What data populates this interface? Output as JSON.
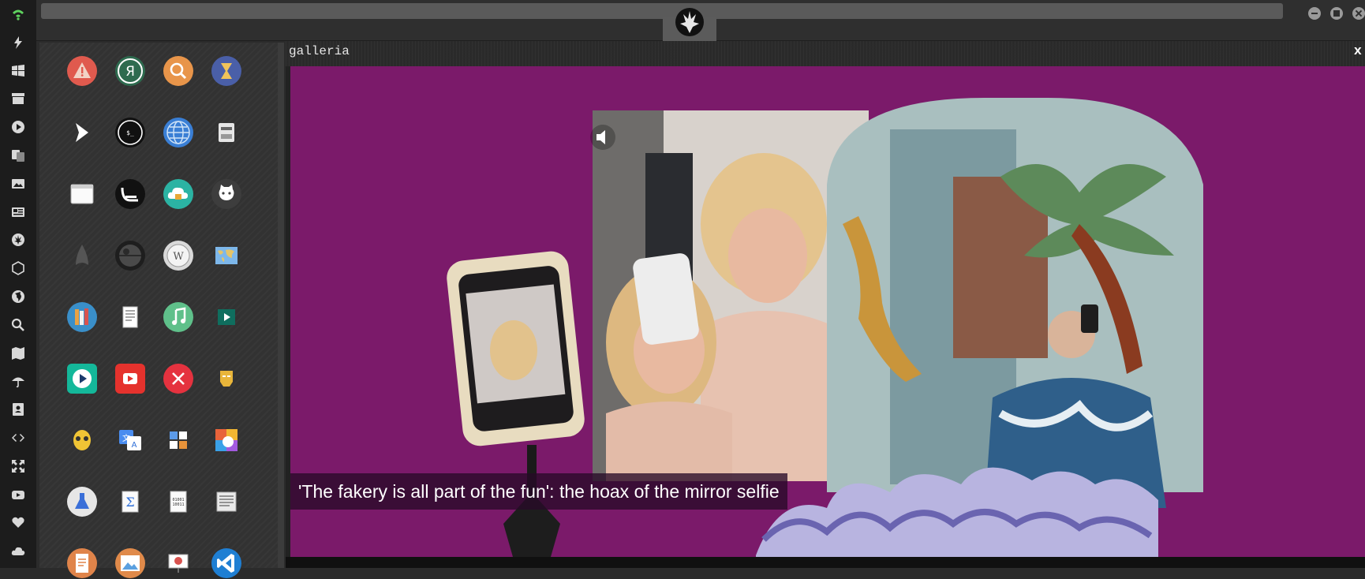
{
  "dock": {
    "items": [
      {
        "icon": "wifi-icon"
      },
      {
        "icon": "lightning-icon"
      },
      {
        "icon": "windows-icon"
      },
      {
        "icon": "archive-icon"
      },
      {
        "icon": "play-circle-icon"
      },
      {
        "icon": "translate-icon"
      },
      {
        "icon": "image-icon"
      },
      {
        "icon": "newspaper-icon"
      },
      {
        "icon": "rebel-alliance-icon"
      },
      {
        "icon": "hexagon-icon"
      },
      {
        "icon": "globe-icon"
      },
      {
        "icon": "search-icon"
      },
      {
        "icon": "map-icon"
      },
      {
        "icon": "umbrella-icon"
      },
      {
        "icon": "contact-card-icon"
      },
      {
        "icon": "code-icon"
      },
      {
        "icon": "expand-icon"
      },
      {
        "icon": "youtube-icon"
      },
      {
        "icon": "heart-icon"
      },
      {
        "icon": "cloud-icon"
      }
    ]
  },
  "topbar": {
    "logo_icon": "rebel-alliance-icon",
    "window_buttons": [
      "minimize-icon",
      "maximize-icon",
      "close-icon"
    ]
  },
  "launcher": {
    "apps": [
      {
        "icon": "warning-icon",
        "color": "#e05a4e"
      },
      {
        "icon": "yandex-icon",
        "color": "#2e6b4f"
      },
      {
        "icon": "search-icon",
        "color": "#e8954a"
      },
      {
        "icon": "hourglass-icon",
        "color": "#4a5fa8"
      },
      {
        "icon": "chevron-right-icon",
        "color": "#e8622a"
      },
      {
        "icon": "terminal-icon",
        "color": "#111111"
      },
      {
        "icon": "globe-icon",
        "color": "#3a7fd5"
      },
      {
        "icon": "disk-icon",
        "color": "#bdbdbd"
      },
      {
        "icon": "browser-window-icon",
        "color": "#e6e6e6"
      },
      {
        "icon": "keyboard-icon",
        "color": "#111111"
      },
      {
        "icon": "cloud-lock-icon",
        "color": "#2bb3a3"
      },
      {
        "icon": "github-icon",
        "color": "#3d3d3d"
      },
      {
        "icon": "starfleet-icon",
        "color": "#1e1e1e"
      },
      {
        "icon": "death-star-icon",
        "color": "#1e1e1e"
      },
      {
        "icon": "wikipedia-icon",
        "color": "#d9d9d9"
      },
      {
        "icon": "world-map-icon",
        "color": "#4c8fd6"
      },
      {
        "icon": "books-icon",
        "color": "#3a8fc9"
      },
      {
        "icon": "document-icon",
        "color": "#efefef"
      },
      {
        "icon": "music-note-icon",
        "color": "#5fc08a"
      },
      {
        "icon": "video-icon",
        "color": "#1a8f7a"
      },
      {
        "icon": "play-icon",
        "color": "#14b89a"
      },
      {
        "icon": "youtube-icon",
        "color": "#e5322d"
      },
      {
        "icon": "close-circle-icon",
        "color": "#e5323f"
      },
      {
        "icon": "iron-man-icon",
        "color": "#b22d2d"
      },
      {
        "icon": "c3po-icon",
        "color": "#d9a51e"
      },
      {
        "icon": "translate-icon",
        "color": "#2e6fd8"
      },
      {
        "icon": "calculator-icon",
        "color": "#2f74d0"
      },
      {
        "icon": "photos-icon",
        "color": "#e26a3b"
      },
      {
        "icon": "flask-icon",
        "color": "#e6e6e6"
      },
      {
        "icon": "sigma-icon",
        "color": "#efefef"
      },
      {
        "icon": "binary-file-icon",
        "color": "#efefef"
      },
      {
        "icon": "text-document-icon",
        "color": "#d6d6d6"
      },
      {
        "icon": "file-icon",
        "color": "#e0844a"
      },
      {
        "icon": "image-viewer-icon",
        "color": "#e08a4a"
      },
      {
        "icon": "presentation-icon",
        "color": "#e6e6e6"
      },
      {
        "icon": "vscode-icon",
        "color": "#1f7fd3"
      }
    ]
  },
  "gallery": {
    "title": "galleria",
    "close_label": "x",
    "caption": "'The fakery is all part of the fun': the hoax of the mirror selfie",
    "background_color": "#7b1a6a"
  }
}
